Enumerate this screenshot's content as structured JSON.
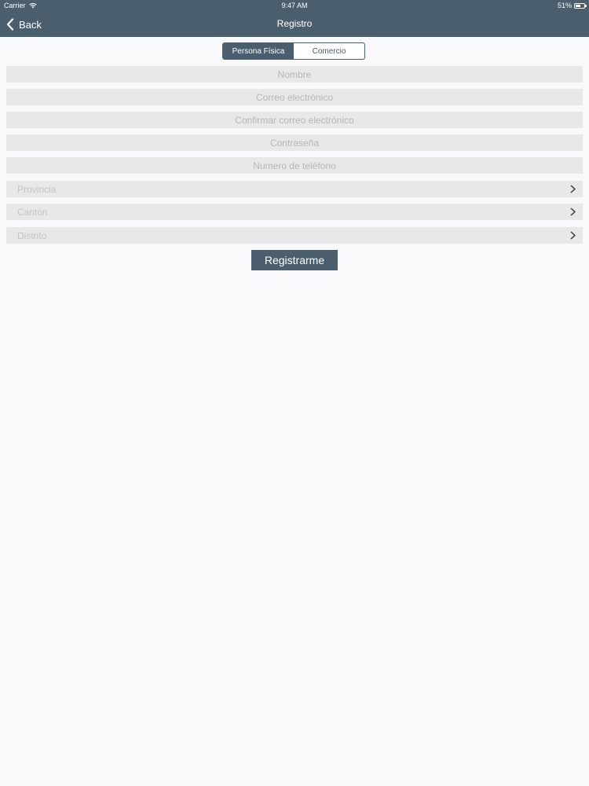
{
  "status_bar": {
    "carrier": "Carrier",
    "time": "9:47 AM",
    "battery": "51%"
  },
  "nav": {
    "back_label": "Back",
    "title": "Registro"
  },
  "segments": [
    "Persona Física",
    "Comercio"
  ],
  "selected_segment": "Persona Física",
  "fields": {
    "nombre": {
      "placeholder": "Nombre",
      "value": ""
    },
    "correo": {
      "placeholder": "Correo electrónico",
      "value": ""
    },
    "confirmar_correo": {
      "placeholder": "Confirmar correo electrónico",
      "value": ""
    },
    "contrasena": {
      "placeholder": "Contraseña",
      "value": ""
    },
    "telefono": {
      "placeholder": "Numero de teléfono",
      "value": ""
    }
  },
  "pickers": {
    "provincia": "Provincia",
    "canton": "Cantón",
    "distrito": "Distrito"
  },
  "submit_label": "Registrarme",
  "icons": {
    "back": "chevron-left-icon",
    "picker": "chevron-right-icon",
    "wifi": "wifi-icon",
    "battery": "battery-icon"
  },
  "colors": {
    "bar": "#4a5e6d",
    "field_bg": "#e8e8e8",
    "page_bg": "#f9f9fb"
  }
}
